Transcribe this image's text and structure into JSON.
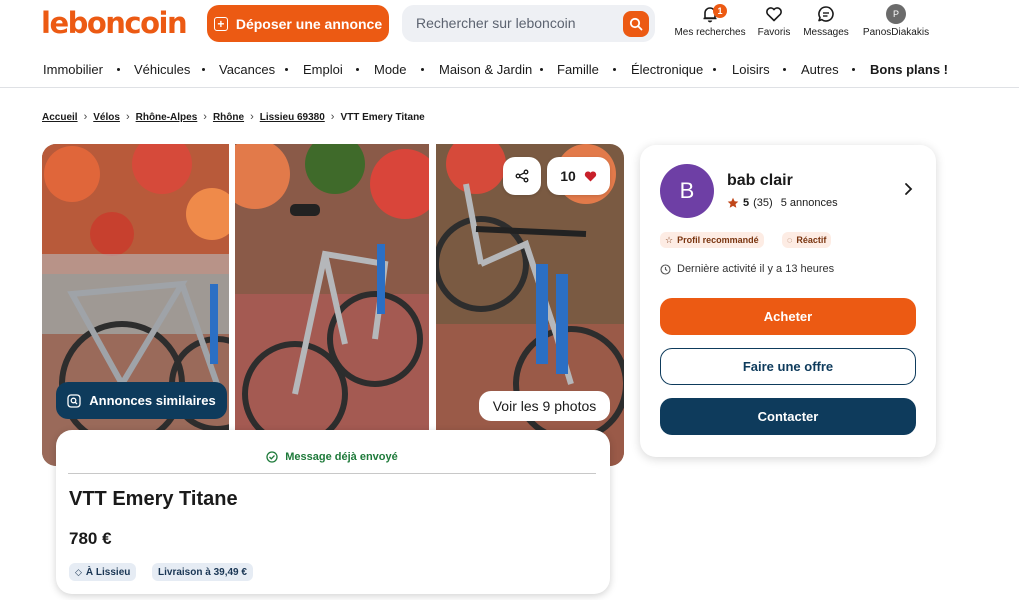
{
  "header": {
    "logo": "leboncoin",
    "post_label": "Déposer une annonce",
    "search_placeholder": "Rechercher sur leboncoin",
    "my_searches": {
      "label": "Mes recherches",
      "badge": "1"
    },
    "favorites": "Favoris",
    "messages": "Messages",
    "user": {
      "initial": "P",
      "name": "PanosDiakakis"
    }
  },
  "categories": [
    "Immobilier",
    "Véhicules",
    "Vacances",
    "Emploi",
    "Mode",
    "Maison & Jardin",
    "Famille",
    "Électronique",
    "Loisirs",
    "Autres",
    "Bons plans !"
  ],
  "breadcrumb": {
    "items": [
      "Accueil",
      "Vélos",
      "Rhône-Alpes",
      "Rhône",
      "Lissieu 69380"
    ],
    "current": "VTT Emery Titane"
  },
  "gallery": {
    "favorites_count": "10",
    "similar_label": "Annonces similaires",
    "photos_label": "Voir les 9 photos"
  },
  "ad": {
    "message_status": "Message déjà envoyé",
    "title": "VTT Emery Titane",
    "price": "780 €",
    "location": "À Lissieu",
    "delivery": "Livraison à 39,49 €"
  },
  "seller": {
    "initial": "B",
    "name": "bab clair",
    "rating": "5",
    "reviews": "(35)",
    "listings": "5 annonces",
    "badges": [
      "Profil recommandé",
      "Réactif"
    ],
    "activity": "Dernière activité il y a 13 heures",
    "buy_label": "Acheter",
    "offer_label": "Faire une offre",
    "contact_label": "Contacter"
  },
  "colors": {
    "brand": "#ec5a13",
    "navy": "#0e3b5c",
    "success": "#1e7a3a"
  }
}
